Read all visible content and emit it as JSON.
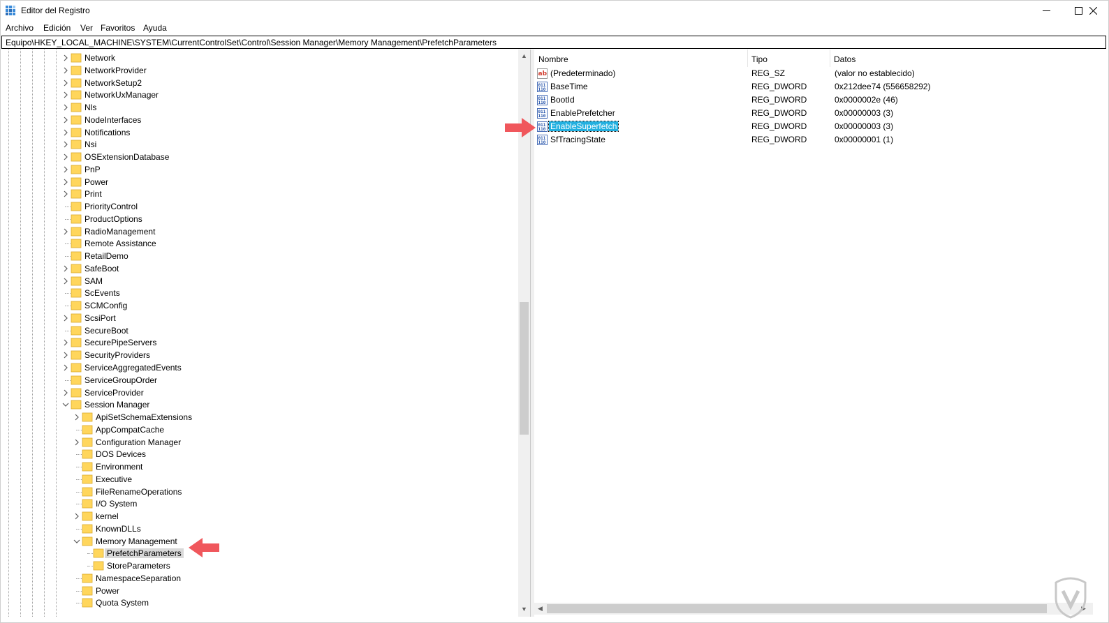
{
  "window": {
    "title": "Editor del Registro",
    "minimize_glyph": "—",
    "maximize_glyph": "☐",
    "close_glyph": "✕"
  },
  "menu": [
    "Archivo",
    "Edición",
    "Ver",
    "Favoritos",
    "Ayuda"
  ],
  "address": "Equipo\\HKEY_LOCAL_MACHINE\\SYSTEM\\CurrentControlSet\\Control\\Session Manager\\Memory Management\\PrefetchParameters",
  "tree": {
    "items": [
      {
        "label": "Network",
        "expander": "collapsed",
        "depth": 0
      },
      {
        "label": "NetworkProvider",
        "expander": "collapsed",
        "depth": 0
      },
      {
        "label": "NetworkSetup2",
        "expander": "collapsed",
        "depth": 0
      },
      {
        "label": "NetworkUxManager",
        "expander": "collapsed",
        "depth": 0
      },
      {
        "label": "Nls",
        "expander": "collapsed",
        "depth": 0
      },
      {
        "label": "NodeInterfaces",
        "expander": "collapsed",
        "depth": 0
      },
      {
        "label": "Notifications",
        "expander": "collapsed",
        "depth": 0
      },
      {
        "label": "Nsi",
        "expander": "collapsed",
        "depth": 0
      },
      {
        "label": "OSExtensionDatabase",
        "expander": "collapsed",
        "depth": 0
      },
      {
        "label": "PnP",
        "expander": "collapsed",
        "depth": 0
      },
      {
        "label": "Power",
        "expander": "collapsed",
        "depth": 0
      },
      {
        "label": "Print",
        "expander": "collapsed",
        "depth": 0
      },
      {
        "label": "PriorityControl",
        "expander": "none",
        "depth": 0
      },
      {
        "label": "ProductOptions",
        "expander": "none",
        "depth": 0
      },
      {
        "label": "RadioManagement",
        "expander": "collapsed",
        "depth": 0
      },
      {
        "label": "Remote Assistance",
        "expander": "none",
        "depth": 0
      },
      {
        "label": "RetailDemo",
        "expander": "none",
        "depth": 0
      },
      {
        "label": "SafeBoot",
        "expander": "collapsed",
        "depth": 0
      },
      {
        "label": "SAM",
        "expander": "collapsed",
        "depth": 0
      },
      {
        "label": "ScEvents",
        "expander": "none",
        "depth": 0
      },
      {
        "label": "SCMConfig",
        "expander": "none",
        "depth": 0
      },
      {
        "label": "ScsiPort",
        "expander": "collapsed",
        "depth": 0
      },
      {
        "label": "SecureBoot",
        "expander": "none",
        "depth": 0
      },
      {
        "label": "SecurePipeServers",
        "expander": "collapsed",
        "depth": 0
      },
      {
        "label": "SecurityProviders",
        "expander": "collapsed",
        "depth": 0
      },
      {
        "label": "ServiceAggregatedEvents",
        "expander": "collapsed",
        "depth": 0
      },
      {
        "label": "ServiceGroupOrder",
        "expander": "none",
        "depth": 0
      },
      {
        "label": "ServiceProvider",
        "expander": "collapsed",
        "depth": 0
      },
      {
        "label": "Session Manager",
        "expander": "expanded",
        "depth": 0
      },
      {
        "label": "ApiSetSchemaExtensions",
        "expander": "collapsed",
        "depth": 1
      },
      {
        "label": "AppCompatCache",
        "expander": "none",
        "depth": 1
      },
      {
        "label": "Configuration Manager",
        "expander": "collapsed",
        "depth": 1
      },
      {
        "label": "DOS Devices",
        "expander": "none",
        "depth": 1
      },
      {
        "label": "Environment",
        "expander": "none",
        "depth": 1
      },
      {
        "label": "Executive",
        "expander": "none",
        "depth": 1
      },
      {
        "label": "FileRenameOperations",
        "expander": "none",
        "depth": 1
      },
      {
        "label": "I/O System",
        "expander": "none",
        "depth": 1
      },
      {
        "label": "kernel",
        "expander": "collapsed",
        "depth": 1
      },
      {
        "label": "KnownDLLs",
        "expander": "none",
        "depth": 1
      },
      {
        "label": "Memory Management",
        "expander": "expanded",
        "depth": 1
      },
      {
        "label": "PrefetchParameters",
        "expander": "none",
        "depth": 2,
        "selected": true
      },
      {
        "label": "StoreParameters",
        "expander": "none",
        "depth": 2
      },
      {
        "label": "NamespaceSeparation",
        "expander": "none",
        "depth": 1
      },
      {
        "label": "Power",
        "expander": "none",
        "depth": 1
      },
      {
        "label": "Quota System",
        "expander": "none",
        "depth": 1
      }
    ]
  },
  "list": {
    "headers": {
      "name": "Nombre",
      "type": "Tipo",
      "data": "Datos"
    },
    "rows": [
      {
        "name": "(Predeterminado)",
        "type": "REG_SZ",
        "data": "(valor no establecido)",
        "icon": "string-value-icon"
      },
      {
        "name": "BaseTime",
        "type": "REG_DWORD",
        "data": "0x212dee74 (556658292)",
        "icon": "binary-value-icon"
      },
      {
        "name": "BootId",
        "type": "REG_DWORD",
        "data": "0x0000002e (46)",
        "icon": "binary-value-icon"
      },
      {
        "name": "EnablePrefetcher",
        "type": "REG_DWORD",
        "data": "0x00000003 (3)",
        "icon": "binary-value-icon"
      },
      {
        "name": "EnableSuperfetch",
        "type": "REG_DWORD",
        "data": "0x00000003 (3)",
        "icon": "binary-value-icon",
        "selected": true
      },
      {
        "name": "SfTracingState",
        "type": "REG_DWORD",
        "data": "0x00000001 (1)",
        "icon": "binary-value-icon"
      }
    ]
  },
  "colors": {
    "selection_blue": "#22b0e0",
    "tree_selection_grey": "#d9d9d9",
    "folder_yellow": "#ffd65c",
    "annotation_arrow": "#f0575c"
  }
}
